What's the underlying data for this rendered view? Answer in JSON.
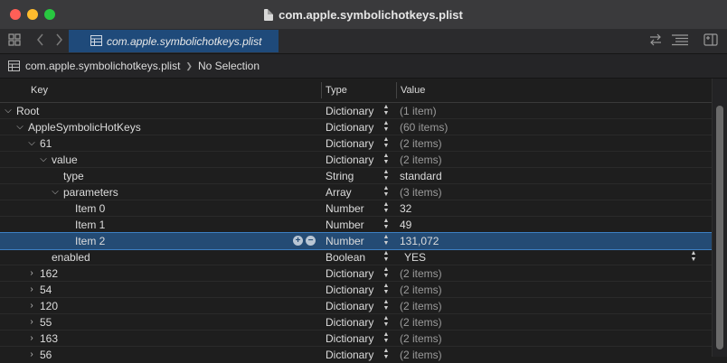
{
  "window": {
    "title": "com.apple.symbolichotkeys.plist"
  },
  "tab": {
    "label": "com.apple.symbolichotkeys.plist"
  },
  "pathbar": {
    "file": "com.apple.symbolichotkeys.plist",
    "separator": "❯",
    "selection": "No Selection"
  },
  "columns": {
    "key": "Key",
    "type": "Type",
    "value": "Value"
  },
  "rows": [
    {
      "key": "Root",
      "type": "Dictionary",
      "value": "(1 item)"
    },
    {
      "key": "AppleSymbolicHotKeys",
      "type": "Dictionary",
      "value": "(60 items)"
    },
    {
      "key": "61",
      "type": "Dictionary",
      "value": "(2 items)"
    },
    {
      "key": "value",
      "type": "Dictionary",
      "value": "(2 items)"
    },
    {
      "key": "type",
      "type": "String",
      "value": "standard"
    },
    {
      "key": "parameters",
      "type": "Array",
      "value": "(3 items)"
    },
    {
      "key": "Item 0",
      "type": "Number",
      "value": "32"
    },
    {
      "key": "Item 1",
      "type": "Number",
      "value": "49"
    },
    {
      "key": "Item 2",
      "type": "Number",
      "value": "131,072"
    },
    {
      "key": "enabled",
      "type": "Boolean",
      "value": "YES"
    },
    {
      "key": "162",
      "type": "Dictionary",
      "value": "(2 items)"
    },
    {
      "key": "54",
      "type": "Dictionary",
      "value": "(2 items)"
    },
    {
      "key": "120",
      "type": "Dictionary",
      "value": "(2 items)"
    },
    {
      "key": "55",
      "type": "Dictionary",
      "value": "(2 items)"
    },
    {
      "key": "163",
      "type": "Dictionary",
      "value": "(2 items)"
    },
    {
      "key": "56",
      "type": "Dictionary",
      "value": "(2 items)"
    }
  ],
  "colors": {
    "selection": "#244b74",
    "tab": "#1f4a7a",
    "background": "#1e1e1e"
  }
}
